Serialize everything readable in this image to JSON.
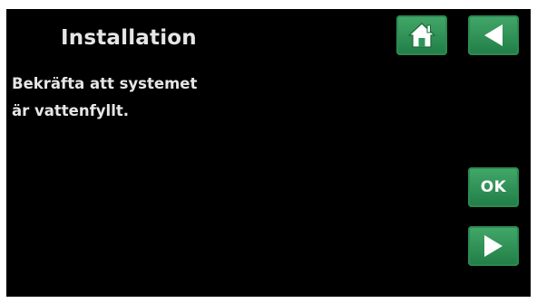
{
  "screen": {
    "title": "Installation",
    "message_lines": [
      "Bekräfta att systemet",
      "är vattenfyllt."
    ]
  },
  "buttons": {
    "home_icon": "home-icon",
    "back_icon": "arrow-left-icon",
    "ok_label": "OK",
    "next_icon": "arrow-right-icon"
  },
  "colors": {
    "background": "#000000",
    "button": "#2e9558",
    "text": "#e6e6e6"
  }
}
